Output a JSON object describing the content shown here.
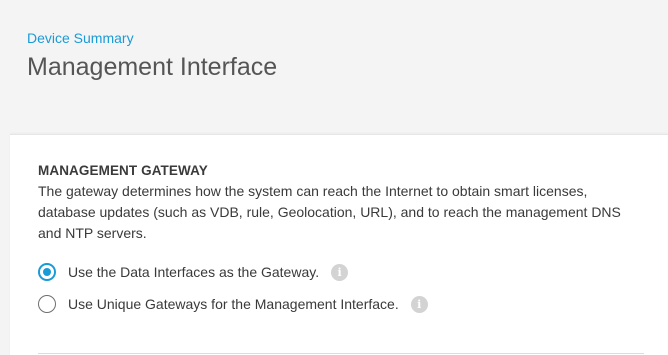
{
  "header": {
    "breadcrumb": "Device Summary",
    "title": "Management Interface"
  },
  "management_gateway": {
    "heading": "MANAGEMENT GATEWAY",
    "description": "The gateway determines how the system can reach the Internet to obtain smart licenses, database updates (such as VDB, rule, Geolocation, URL), and to reach the management DNS and NTP servers.",
    "options": [
      {
        "label": "Use the Data Interfaces as the Gateway.",
        "selected": true,
        "info_icon": "info-icon"
      },
      {
        "label": "Use Unique Gateways for the Management Interface.",
        "selected": false,
        "info_icon": "info-icon"
      }
    ]
  },
  "colors": {
    "accent": "#1a9bd7",
    "text": "#3a3a3a",
    "title": "#555555",
    "background": "#f4f4f4",
    "card": "#ffffff"
  }
}
